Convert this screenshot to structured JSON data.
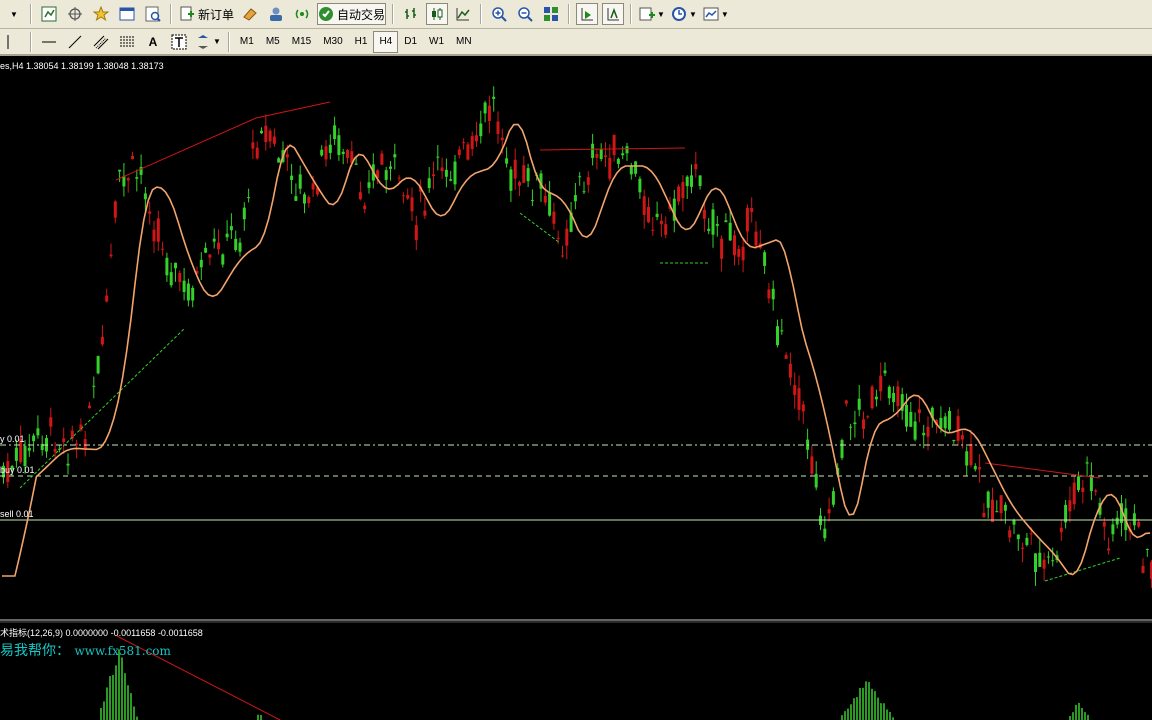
{
  "toolbar1": {
    "new_order_label": "新订单",
    "auto_trade_label": "自动交易"
  },
  "toolbar2": {
    "text_tool": "A",
    "timeframes": [
      "M1",
      "M5",
      "M15",
      "M30",
      "H1",
      "H4",
      "D1",
      "W1",
      "MN"
    ],
    "active_timeframe": "H4"
  },
  "chart": {
    "title": "es,H4  1.38054 1.38199 1.38048 1.38173",
    "order_lines": [
      {
        "label": "y 0.01"
      },
      {
        "label": "buy 0.01"
      },
      {
        "label": "sell 0.01"
      }
    ],
    "watermark_cn": "易我帮你：",
    "watermark_url": "www.fx581.com",
    "indicator_title": "术指标(12,26,9) 0.0000000 -0.0011658 -0.0011658",
    "colors": {
      "bull_candle": "#34d12a",
      "bear_candle": "#d01616",
      "moving_average": "#f3a46a",
      "order_line": "#c8e8b0",
      "trend_line": "#d01616",
      "histogram": "#2a9a22",
      "watermark": "#14c6c6"
    }
  }
}
